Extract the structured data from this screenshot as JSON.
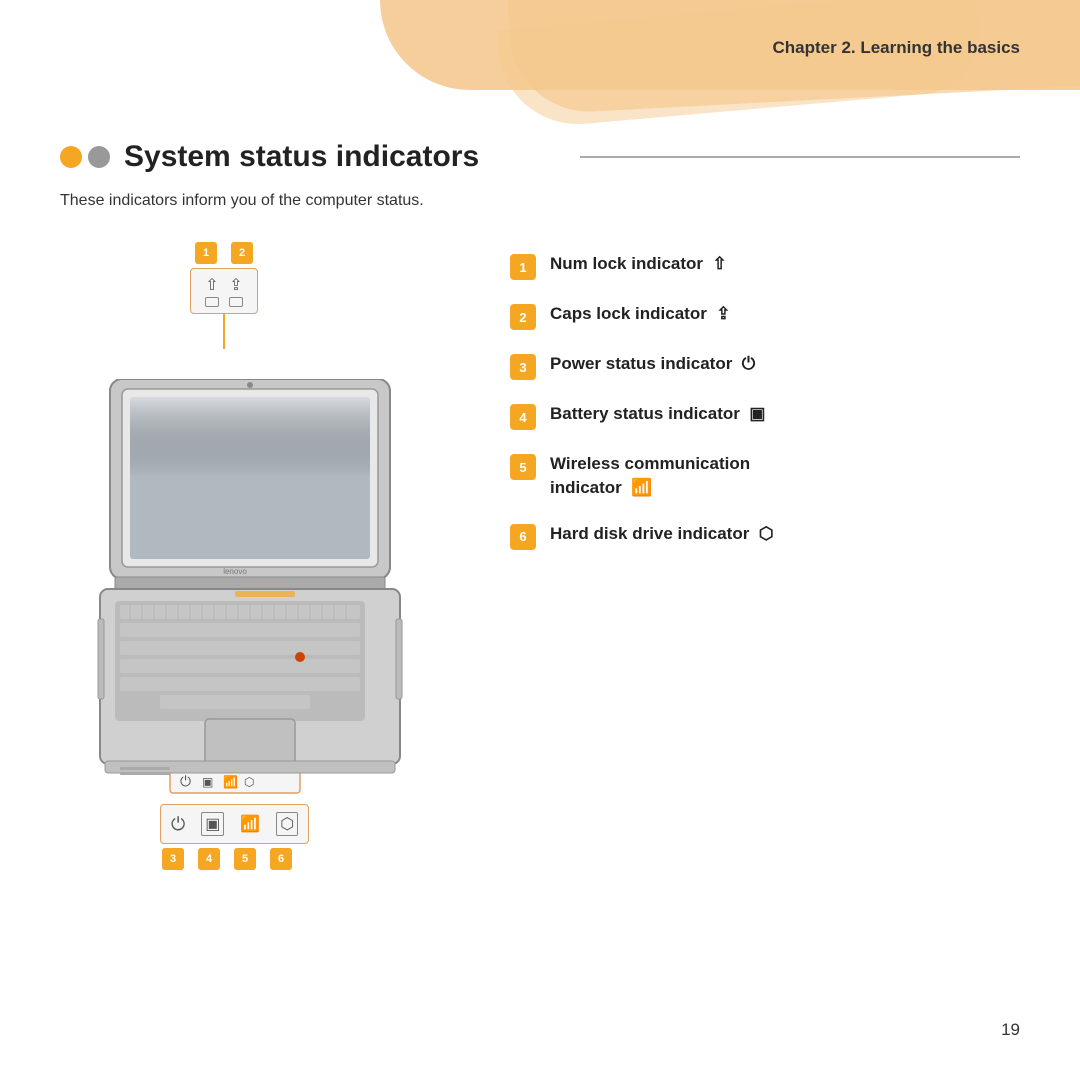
{
  "header": {
    "chapter": "Chapter 2. Learning the basics"
  },
  "section": {
    "title": "System status indicators",
    "description": "These indicators inform you of the computer status."
  },
  "top_indicators": {
    "badges": [
      "1",
      "2"
    ]
  },
  "bottom_indicators": {
    "badges": [
      "3",
      "4",
      "5",
      "6"
    ]
  },
  "indicators_list": [
    {
      "number": "1",
      "text": "Num lock indicator",
      "icon": "⇧"
    },
    {
      "number": "2",
      "text": "Caps lock indicator",
      "icon": "⇪"
    },
    {
      "number": "3",
      "text": "Power status indicator",
      "icon": "⏻"
    },
    {
      "number": "4",
      "text": "Battery status indicator",
      "icon": "🔋"
    },
    {
      "number": "5",
      "text": "Wireless communication indicator",
      "icon": "📶"
    },
    {
      "number": "6",
      "text": "Hard disk drive indicator",
      "icon": "💾"
    }
  ],
  "page_number": "19"
}
